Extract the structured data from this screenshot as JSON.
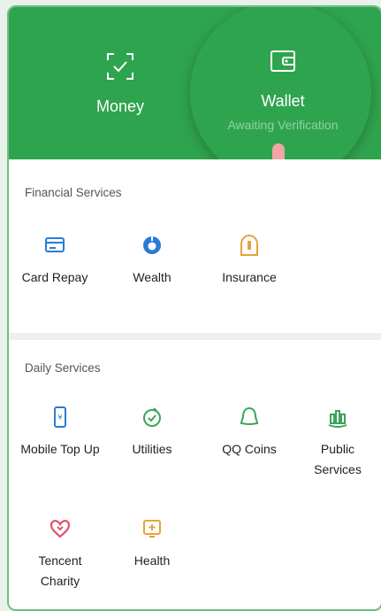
{
  "banner": {
    "money_label": "Money",
    "wallet_label": "Wallet",
    "wallet_status": "Awaiting Verification"
  },
  "financial": {
    "title": "Financial Services",
    "items": [
      {
        "label": "Card Repay",
        "icon": "card-icon"
      },
      {
        "label": "Wealth",
        "icon": "wealth-icon"
      },
      {
        "label": "Insurance",
        "icon": "insurance-icon"
      }
    ]
  },
  "daily": {
    "title": "Daily Services",
    "items": [
      {
        "label": "Mobile Top Up",
        "icon": "phone-icon"
      },
      {
        "label": "Utilities",
        "icon": "utilities-icon"
      },
      {
        "label": "QQ Coins",
        "icon": "qq-icon"
      },
      {
        "label": "Public Services",
        "icon": "public-services-icon"
      },
      {
        "label": "Tencent Charity",
        "icon": "charity-icon"
      },
      {
        "label": "Health",
        "icon": "health-icon"
      }
    ]
  },
  "colors": {
    "brand_green": "#2fa44e",
    "icon_blue": "#2b7bd6",
    "icon_green": "#3aa55a",
    "icon_orange": "#e6a23c",
    "icon_red": "#e0556b"
  }
}
